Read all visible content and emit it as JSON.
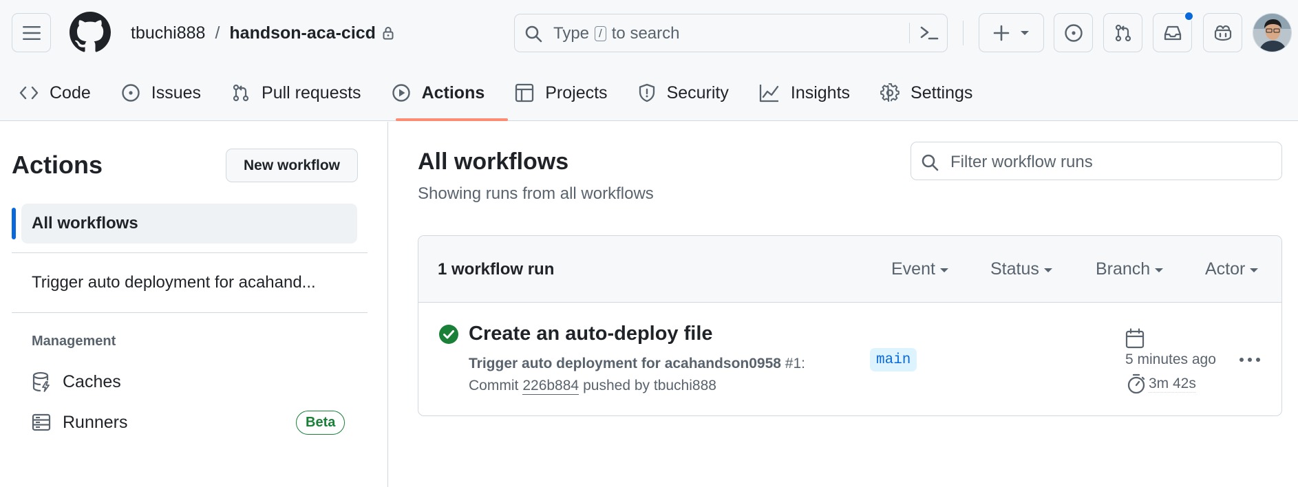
{
  "header": {
    "owner": "tbuchi888",
    "separator": "/",
    "repo": "handson-aca-cicd",
    "search": {
      "before": "Type",
      "key": "/",
      "after": "to search"
    }
  },
  "tabs": [
    {
      "label": "Code",
      "icon": "code-icon"
    },
    {
      "label": "Issues",
      "icon": "issue-opened-icon"
    },
    {
      "label": "Pull requests",
      "icon": "git-pull-request-icon"
    },
    {
      "label": "Actions",
      "icon": "play-icon",
      "active": true
    },
    {
      "label": "Projects",
      "icon": "table-icon"
    },
    {
      "label": "Security",
      "icon": "shield-icon"
    },
    {
      "label": "Insights",
      "icon": "graph-icon"
    },
    {
      "label": "Settings",
      "icon": "gear-icon"
    }
  ],
  "sidebar": {
    "title": "Actions",
    "new_workflow": "New workflow",
    "all_workflows": "All workflows",
    "workflows": [
      "Trigger auto deployment for acahand..."
    ],
    "management_heading": "Management",
    "management": [
      {
        "label": "Caches",
        "icon": "database-icon"
      },
      {
        "label": "Runners",
        "icon": "server-icon",
        "badge": "Beta"
      }
    ]
  },
  "main": {
    "title": "All workflows",
    "subtitle": "Showing runs from all workflows",
    "filter_placeholder": "Filter workflow runs",
    "run_count": "1 workflow run",
    "filters": [
      "Event",
      "Status",
      "Branch",
      "Actor"
    ],
    "run": {
      "title": "Create an auto-deploy file",
      "workflow": "Trigger auto deployment for acahandson0958",
      "number": "#1:",
      "commit_prefix": "Commit",
      "commit_sha": "226b884",
      "pushed_by": "pushed by tbuchi888",
      "branch": "main",
      "time": "5 minutes ago",
      "duration": "3m 42s",
      "status": "success"
    }
  },
  "colors": {
    "accent": "#0969da",
    "active_tab_underline": "#fd8c73",
    "success": "#1a7f37",
    "muted_text": "#59636e"
  }
}
